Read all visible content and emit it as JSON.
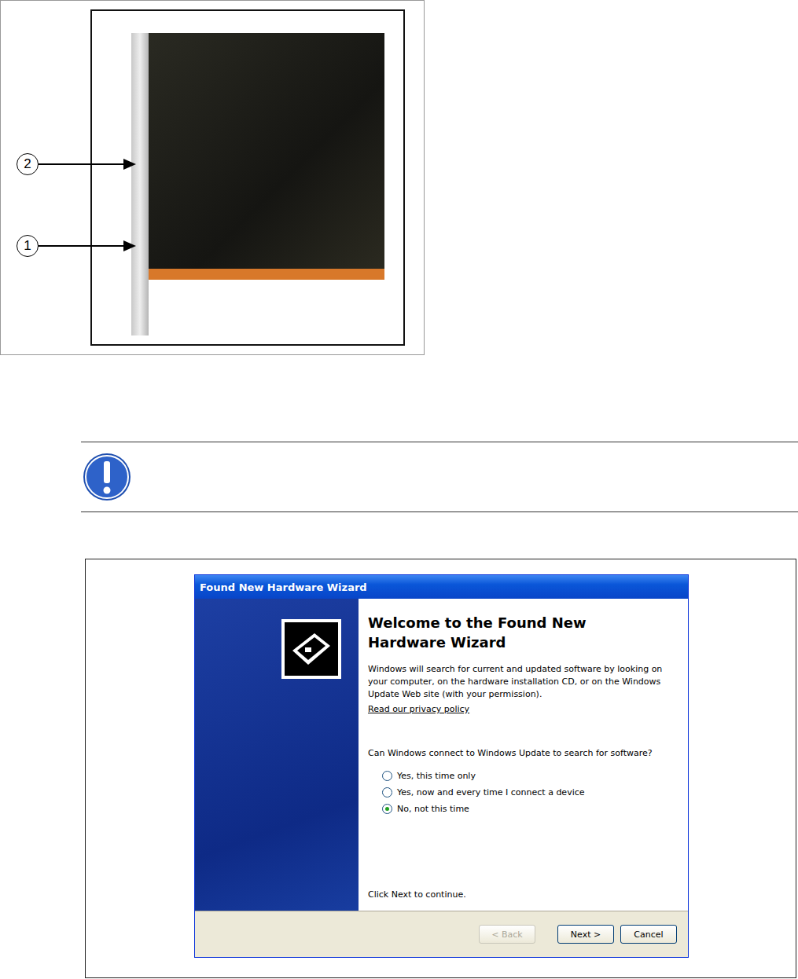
{
  "figure": {
    "callouts": [
      {
        "label": "2"
      },
      {
        "label": "1"
      }
    ]
  },
  "wizard": {
    "title": "Found New Hardware Wizard",
    "heading": "Welcome to the Found New Hardware Wizard",
    "intro": "Windows will search for current and updated software by looking on your computer, on the hardware installation CD, or on the Windows Update Web site (with your permission).",
    "link": "Read our privacy policy",
    "question": "Can Windows connect to Windows Update to search for software?",
    "options": [
      {
        "label": "Yes, this time only",
        "selected": false
      },
      {
        "label": "Yes, now and every time I connect a device",
        "selected": false
      },
      {
        "label": "No, not this time",
        "selected": true
      }
    ],
    "footer": "Click Next to continue.",
    "buttons": [
      {
        "label": "< Back",
        "disabled": true
      },
      {
        "label": "Next >",
        "disabled": false
      },
      {
        "label": "Cancel",
        "disabled": false
      }
    ]
  }
}
